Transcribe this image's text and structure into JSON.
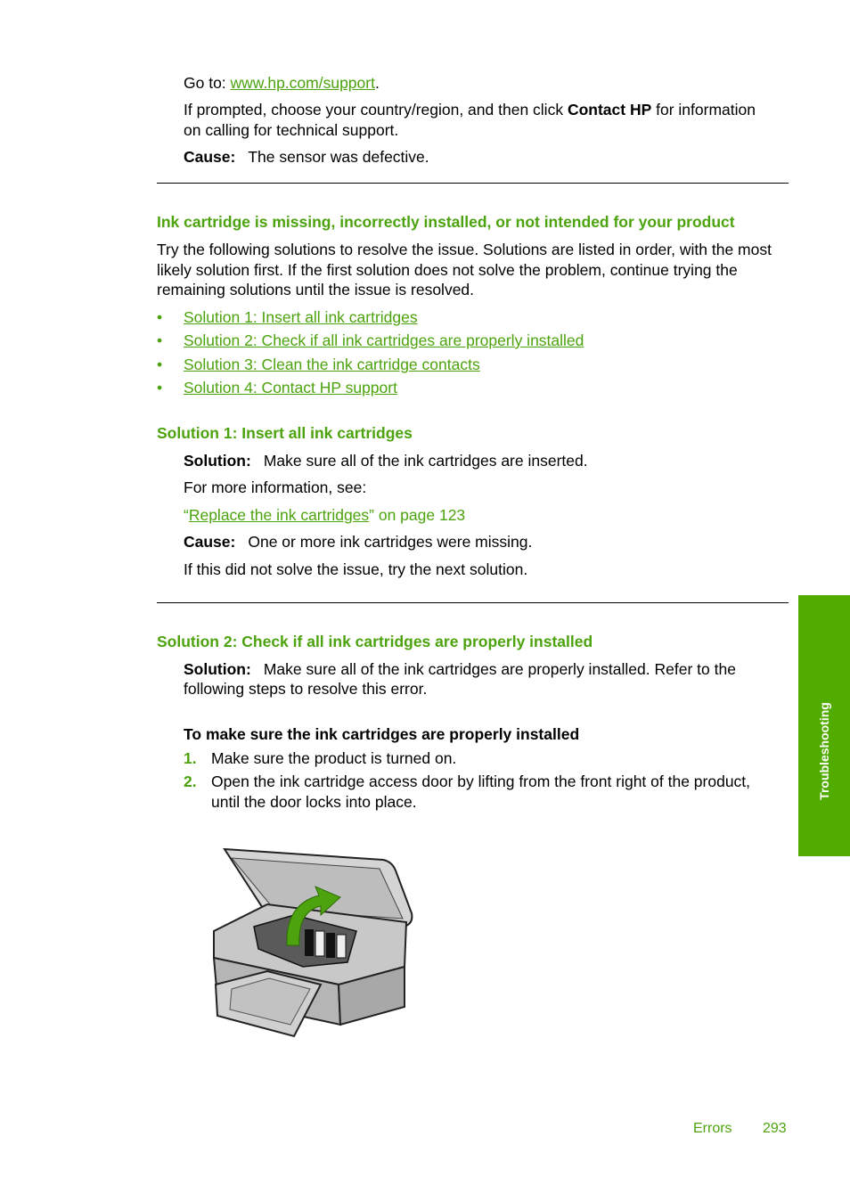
{
  "top": {
    "goto_prefix": "Go to: ",
    "goto_link": "www.hp.com/support",
    "goto_suffix": ".",
    "prompt_line1_a": "If prompted, choose your country/region, and then click ",
    "prompt_line1_bold": "Contact HP",
    "prompt_line1_b": " for information",
    "prompt_line2": "on calling for technical support.",
    "cause_label": "Cause:",
    "cause_text": "The sensor was defective."
  },
  "section": {
    "heading": "Ink cartridge is missing, incorrectly installed, or not intended for your product",
    "intro_lines": [
      "Try the following solutions to resolve the issue. Solutions are listed in order, with the most",
      "likely solution first. If the first solution does not solve the problem, continue trying the",
      "remaining solutions until the issue is resolved."
    ],
    "bullet_glyph": "•",
    "solutions": [
      "Solution 1: Insert all ink cartridges",
      "Solution 2: Check if all ink cartridges are properly installed",
      "Solution 3: Clean the ink cartridge contacts",
      "Solution 4: Contact HP support"
    ]
  },
  "solution1": {
    "heading": "Solution 1: Insert all ink cartridges",
    "solution_label": "Solution:",
    "solution_text": "Make sure all of the ink cartridges are inserted.",
    "more_info": "For more information, see:",
    "ref_open_quote": "“",
    "ref_link": "Replace the ink cartridges",
    "ref_rest": "” on page 123",
    "cause_label": "Cause:",
    "cause_text": "One or more ink cartridges were missing.",
    "next": "If this did not solve the issue, try the next solution."
  },
  "solution2": {
    "heading": "Solution 2: Check if all ink cartridges are properly installed",
    "solution_label": "Solution:",
    "solution_line1": "Make sure all of the ink cartridges are properly installed. Refer to the",
    "solution_line2": "following steps to resolve this error.",
    "procedure_title": "To make sure the ink cartridges are properly installed",
    "steps": [
      {
        "num": "1.",
        "lines": [
          "Make sure the product is turned on."
        ]
      },
      {
        "num": "2.",
        "lines": [
          "Open the ink cartridge access door by lifting from the front right of the product,",
          "until the door locks into place."
        ]
      }
    ]
  },
  "sidetab": {
    "label": "Troubleshooting"
  },
  "footer": {
    "section": "Errors",
    "page": "293"
  },
  "colors": {
    "accent": "#4ca30d",
    "tab": "#52ac00"
  }
}
